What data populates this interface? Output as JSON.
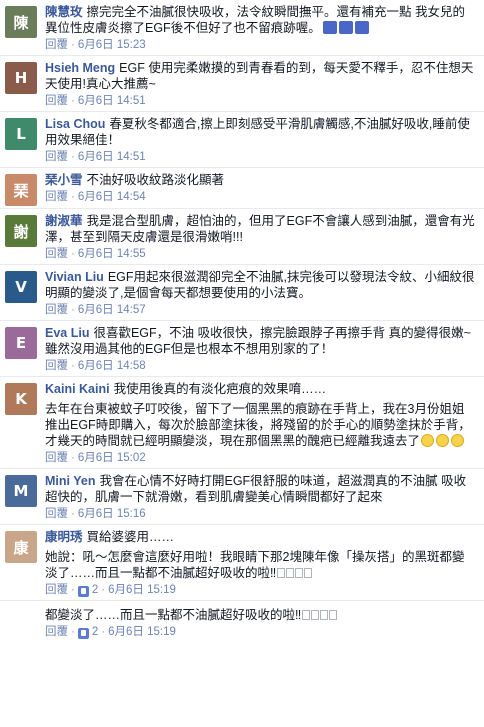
{
  "colors": {
    "author": "#3b5998",
    "link": "#6d84b4",
    "meta": "#9197a3",
    "text": "#141823"
  },
  "labels": {
    "reply": "回覆",
    "separator": "·"
  },
  "comments": [
    {
      "author": "陳慧玫",
      "text": "擦完完全不油膩很快吸收，法令紋瞬間撫平。還有補充一點 我女兒的異位性皮膚炎擦了EGF後不但好了也不留痕跡喔。",
      "date": "6月6日 15:23",
      "avatar_color": "#6b7c5a",
      "has_thumbs": true
    },
    {
      "author": "Hsieh Meng",
      "text": "EGF 使用完柔嫩摸的到青春看的到，每天愛不釋手，忍不住想天天使用!真心大推薦~",
      "date": "6月6日 14:51",
      "avatar_color": "#8a5a4a"
    },
    {
      "author": "Lisa Chou",
      "text": "春夏秋冬都適合,擦上即刻感受平滑肌膚觸感,不油膩好吸收,睡前使用效果絕佳！",
      "date": "6月6日 14:51",
      "avatar_color": "#3f8a6a"
    },
    {
      "author": "琹小雪",
      "text": "不油好吸收紋路淡化顯著",
      "date": "6月6日 14:54",
      "avatar_color": "#c98a6a"
    },
    {
      "author": "謝淑華",
      "text": "我是混合型肌膚，超怕油的，但用了EGF不會讓人感到油膩，還會有光澤，甚至到隔天皮膚還是很滑嫩哨!!!",
      "date": "6月6日 14:55",
      "avatar_color": "#5a7a3a"
    },
    {
      "author": "Vivian Liu",
      "text": "EGF用起來很滋潤卻完全不油膩,抹完後可以發現法令紋、小細紋很明顯的變淡了,是個會每天都想要使用的小法寶。",
      "date": "6月6日 14:57",
      "avatar_color": "#2a5a8a"
    },
    {
      "author": "Eva Liu",
      "text": "很喜歡EGF，不油 吸收很快，擦完臉跟脖子再擦手背 真的變得很嫩~雖然沒用過其他的EGF但是也根本不想用別家的了！",
      "date": "6月6日 14:58",
      "avatar_color": "#9a6a9a"
    },
    {
      "author": "Kaini Kaini",
      "text": "我使用後真的有淡化疤痕的效果唷……",
      "extra": "去年在台東被蚊子叮咬後，留下了一個黑黑的痕跡在手背上，我在3月份姐姐推出EGF時即購入，每次於臉部塗抹後，將殘留的於手心的順勢塗抹於手背，才幾天的時間就已經明顯變淡，現在那個黑黑的醜疤已經離我遠去了",
      "date": "6月6日 15:02",
      "avatar_color": "#b07a5a",
      "emoji_count": 3
    },
    {
      "author": "Mini Yen",
      "text": "我會在心情不好時打開EGF很舒服的味道，超滋潤真的不油膩 吸收超快的，肌膚一下就滑嫩，看到肌膚變美心情瞬間都好了起來",
      "date": "6月6日 15:16",
      "avatar_color": "#4a6a9a"
    },
    {
      "author": "康明琇",
      "text": "買給婆婆用……",
      "extra": "她說：吼～怎麼會這麼好用啦！我眼睛下那2塊陳年像「操灰搭」的黑斑都變淡了……而且一點都不油膩超好吸收的啦‼",
      "date": "6月6日 15:19",
      "likes": "2",
      "avatar_color": "#c9a58a",
      "box_count": 4
    }
  ],
  "trailing": {
    "text": "都變淡了……而且一點都不油膩超好吸收的啦‼",
    "date": "6月6日 15:19",
    "likes": "2",
    "box_count": 4
  }
}
